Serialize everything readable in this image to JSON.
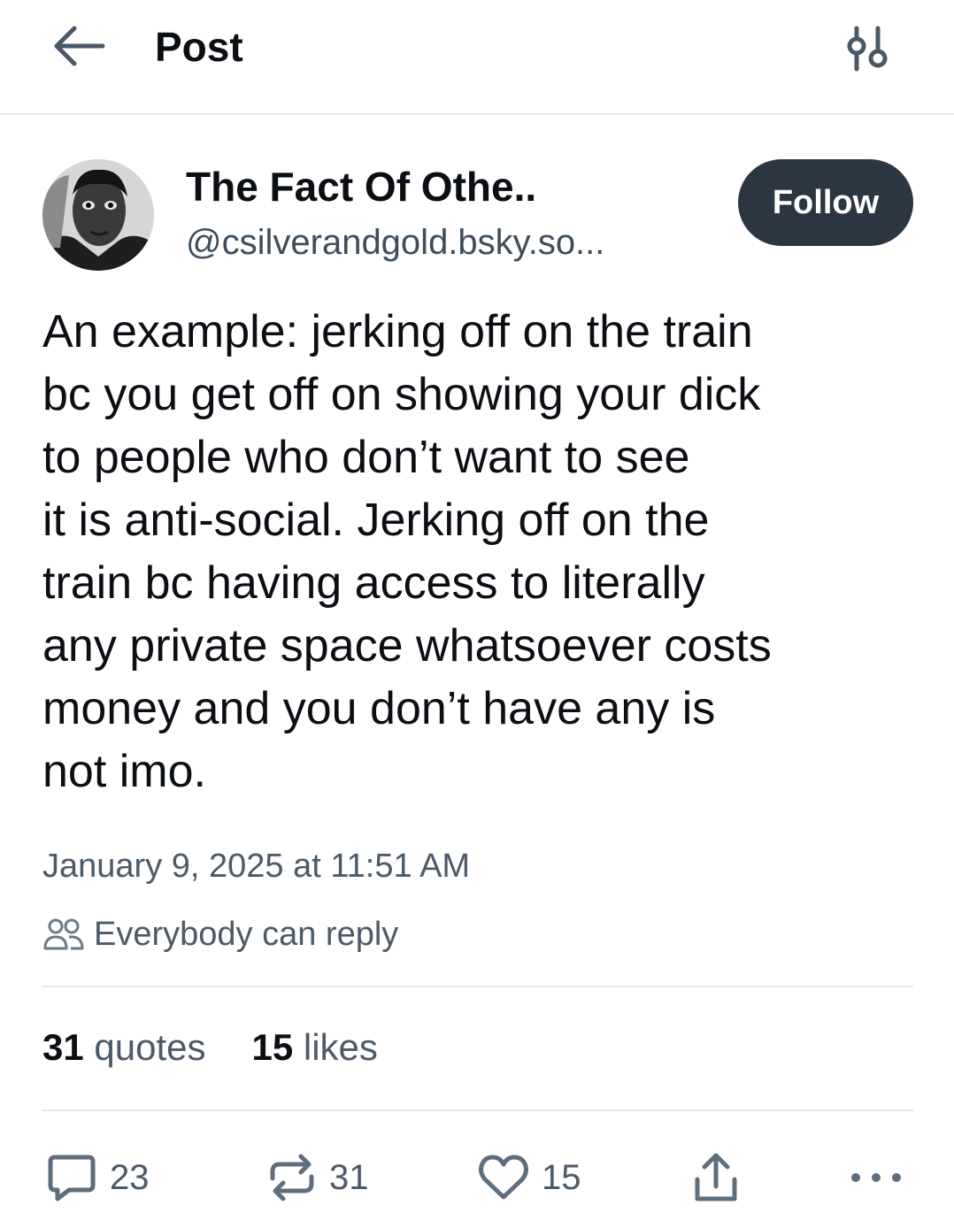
{
  "header": {
    "title": "Post"
  },
  "author": {
    "display_name": "The Fact Of Othe..",
    "handle": "@csilverandgold.bsky.so...",
    "follow_label": "Follow"
  },
  "post": {
    "text": "An example: jerking off on the train\nbc you get off on showing your dick\nto people who don’t want to see\nit is anti-social. Jerking off on the\ntrain bc having access to literally\nany private space whatsoever costs\nmoney and you don’t have any is\nnot imo.",
    "timestamp": "January 9, 2025 at 11:51 AM",
    "reply_setting": "Everybody can reply"
  },
  "stats": {
    "quotes_count": "31",
    "quotes_label": "quotes",
    "likes_count": "15",
    "likes_label": "likes"
  },
  "actions": {
    "reply_count": "23",
    "repost_count": "31",
    "like_count": "15"
  },
  "icons": {
    "back": "arrow-left-icon",
    "filter": "sliders-icon",
    "reply_setting": "people-icon",
    "reply": "speech-bubble-icon",
    "repost": "repost-icon",
    "like": "heart-icon",
    "share": "share-icon",
    "more": "ellipsis-icon"
  },
  "colors": {
    "follow_button": "#2b3642",
    "muted_text": "#4c5a67",
    "divider": "#e5e8eb"
  }
}
